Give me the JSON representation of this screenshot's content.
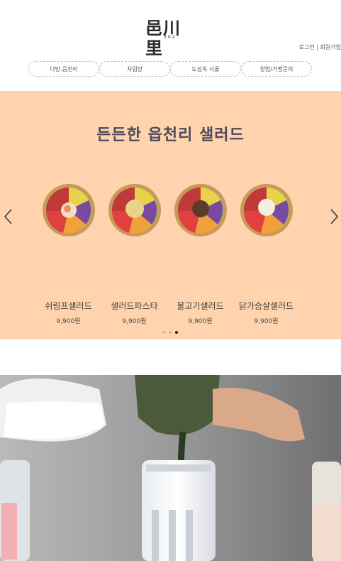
{
  "header": {
    "logo_text": "邑川里",
    "logo_sub": "302",
    "auth": {
      "login": "로그인",
      "divider": " | ",
      "signup": "회원가입"
    },
    "nav": [
      {
        "label": "다방.읍천리"
      },
      {
        "label": "차림상"
      },
      {
        "label": "도심속 시골"
      },
      {
        "label": "창업/가맹문의"
      }
    ]
  },
  "banner": {
    "title": "든든한 읍천리 샐러드",
    "background": "#fed3ad",
    "products": [
      {
        "name": "쉬림프샐러드",
        "price": "9,900원",
        "icon": "shrimp-salad-bowl"
      },
      {
        "name": "샐러드파스타",
        "price": "9,900원",
        "icon": "pasta-salad-bowl"
      },
      {
        "name": "불고기샐러드",
        "price": "9,900원",
        "icon": "bulgogi-salad-bowl"
      },
      {
        "name": "닭가슴살샐러드",
        "price": "9,900원",
        "icon": "chicken-salad-bowl"
      }
    ],
    "pagination": {
      "total": 3,
      "active": 3
    }
  },
  "photo": {
    "subject": "milk-tea-pour-photo"
  }
}
